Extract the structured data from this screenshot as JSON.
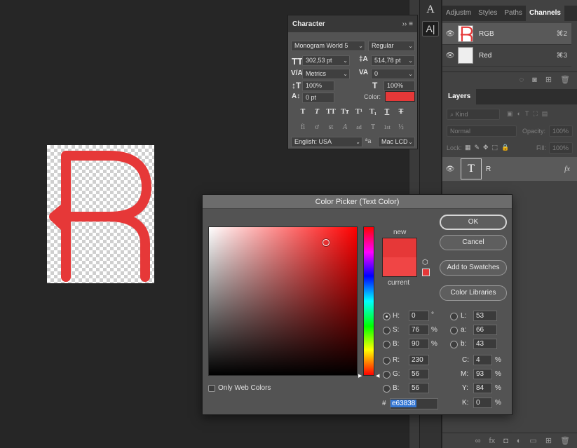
{
  "document": {
    "glyph": "R",
    "glyph_color": "#e63838"
  },
  "tool_strip": {
    "buttons": [
      "A",
      "A|"
    ]
  },
  "channels_panel": {
    "tabs": [
      "Adjustm",
      "Styles",
      "Paths",
      "Channels"
    ],
    "active_tab": "Channels",
    "rows": [
      {
        "name": "RGB",
        "shortcut": "⌘2"
      },
      {
        "name": "Red",
        "shortcut": "⌘3"
      }
    ]
  },
  "layers_panel": {
    "tab": "Layers",
    "filter_placeholder": "Kind",
    "blend_mode": "Normal",
    "opacity_label": "Opacity:",
    "opacity_value": "100%",
    "lock_label": "Lock:",
    "fill_label": "Fill:",
    "fill_value": "100%",
    "layer_name": "R",
    "layer_thumb": "T",
    "fx_label": "fx"
  },
  "character_panel": {
    "title": "Character",
    "font_family": "Monogram World 5",
    "font_style": "Regular",
    "font_size": "302,53 pt",
    "leading": "514,78 pt",
    "kerning": "Metrics",
    "tracking": "0",
    "vertical_scale": "100%",
    "horizontal_scale": "100%",
    "baseline_shift": "0 pt",
    "color_label": "Color:",
    "color": "#e63838",
    "language": "English: USA",
    "aa_label": "ªa",
    "anti_alias": "Mac LCD",
    "style_buttons": [
      "T",
      "T",
      "TT",
      "Tт",
      "T¹",
      "T₁",
      "T",
      "T"
    ],
    "opentype_buttons": [
      "fi",
      "ơ",
      "st",
      "A",
      "ad",
      "T",
      "1st",
      "½"
    ]
  },
  "color_picker": {
    "title": "Color Picker (Text Color)",
    "new_label": "new",
    "current_label": "current",
    "new_color": "#e63838",
    "current_color": "#f04545",
    "buttons": {
      "ok": "OK",
      "cancel": "Cancel",
      "add_swatches": "Add to Swatches",
      "color_libraries": "Color Libraries"
    },
    "hsb": [
      {
        "label": "H:",
        "value": "0",
        "unit": "°",
        "selected": true
      },
      {
        "label": "S:",
        "value": "76",
        "unit": "%",
        "selected": false
      },
      {
        "label": "B:",
        "value": "90",
        "unit": "%",
        "selected": false
      }
    ],
    "rgb": [
      {
        "label": "R:",
        "value": "230"
      },
      {
        "label": "G:",
        "value": "56"
      },
      {
        "label": "B:",
        "value": "56"
      }
    ],
    "lab": [
      {
        "label": "L:",
        "value": "53"
      },
      {
        "label": "a:",
        "value": "66"
      },
      {
        "label": "b:",
        "value": "43"
      }
    ],
    "cmyk": [
      {
        "label": "C:",
        "value": "4",
        "unit": "%"
      },
      {
        "label": "M:",
        "value": "93",
        "unit": "%"
      },
      {
        "label": "Y:",
        "value": "84",
        "unit": "%"
      },
      {
        "label": "K:",
        "value": "0",
        "unit": "%"
      }
    ],
    "only_web_colors": "Only Web Colors",
    "hash": "#",
    "hex": "e63838"
  }
}
